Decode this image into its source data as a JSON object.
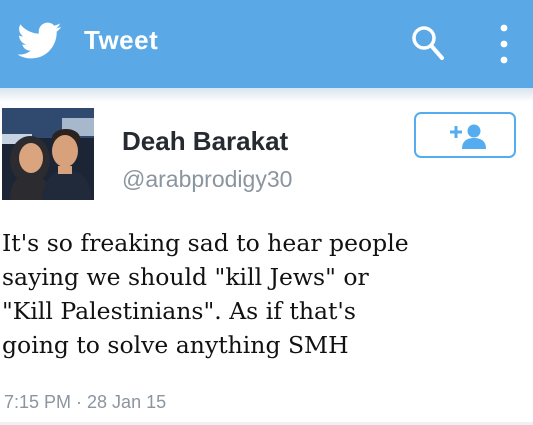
{
  "app_bar": {
    "title": "Tweet",
    "color": "#5aa9e6",
    "icons": [
      "twitter-bird-icon",
      "search-icon",
      "more-vertical-icon"
    ]
  },
  "tweet": {
    "author_name": "Deah Barakat",
    "author_handle": "@arabprodigy30",
    "text": "It's so freaking sad to hear people\nsaying we should \"kill Jews\" or\n\"Kill Palestinians\". As if that's\ngoing to solve anything SMH",
    "timestamp": "7:15 PM · 28 Jan 15",
    "follow_button_icon": "add-user-icon",
    "accent_color": "#55acee"
  }
}
